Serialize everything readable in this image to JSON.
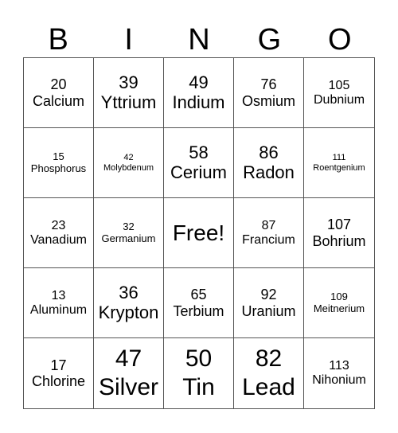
{
  "header": [
    "B",
    "I",
    "N",
    "G",
    "O"
  ],
  "cells": [
    {
      "number": "20",
      "name": "Calcium",
      "size": "s-l"
    },
    {
      "number": "39",
      "name": "Yttrium",
      "size": "s-xl"
    },
    {
      "number": "49",
      "name": "Indium",
      "size": "s-xl"
    },
    {
      "number": "76",
      "name": "Osmium",
      "size": "s-l"
    },
    {
      "number": "105",
      "name": "Dubnium",
      "size": "s-m"
    },
    {
      "number": "15",
      "name": "Phosphorus",
      "size": "s-s"
    },
    {
      "number": "42",
      "name": "Molybdenum",
      "size": "s-xs"
    },
    {
      "number": "58",
      "name": "Cerium",
      "size": "s-xl"
    },
    {
      "number": "86",
      "name": "Radon",
      "size": "s-xl"
    },
    {
      "number": "111",
      "name": "Roentgenium",
      "size": "s-xs"
    },
    {
      "number": "23",
      "name": "Vanadium",
      "size": "s-m"
    },
    {
      "number": "32",
      "name": "Germanium",
      "size": "s-s"
    },
    {
      "free": "Free!"
    },
    {
      "number": "87",
      "name": "Francium",
      "size": "s-m"
    },
    {
      "number": "107",
      "name": "Bohrium",
      "size": "s-l"
    },
    {
      "number": "13",
      "name": "Aluminum",
      "size": "s-m"
    },
    {
      "number": "36",
      "name": "Krypton",
      "size": "s-xl"
    },
    {
      "number": "65",
      "name": "Terbium",
      "size": "s-l"
    },
    {
      "number": "92",
      "name": "Uranium",
      "size": "s-l"
    },
    {
      "number": "109",
      "name": "Meitnerium",
      "size": "s-s"
    },
    {
      "number": "17",
      "name": "Chlorine",
      "size": "s-l"
    },
    {
      "number": "47",
      "name": "Silver",
      "size": "s-xxl"
    },
    {
      "number": "50",
      "name": "Tin",
      "size": "s-xxl"
    },
    {
      "number": "82",
      "name": "Lead",
      "size": "s-xxl"
    },
    {
      "number": "113",
      "name": "Nihonium",
      "size": "s-m"
    }
  ]
}
